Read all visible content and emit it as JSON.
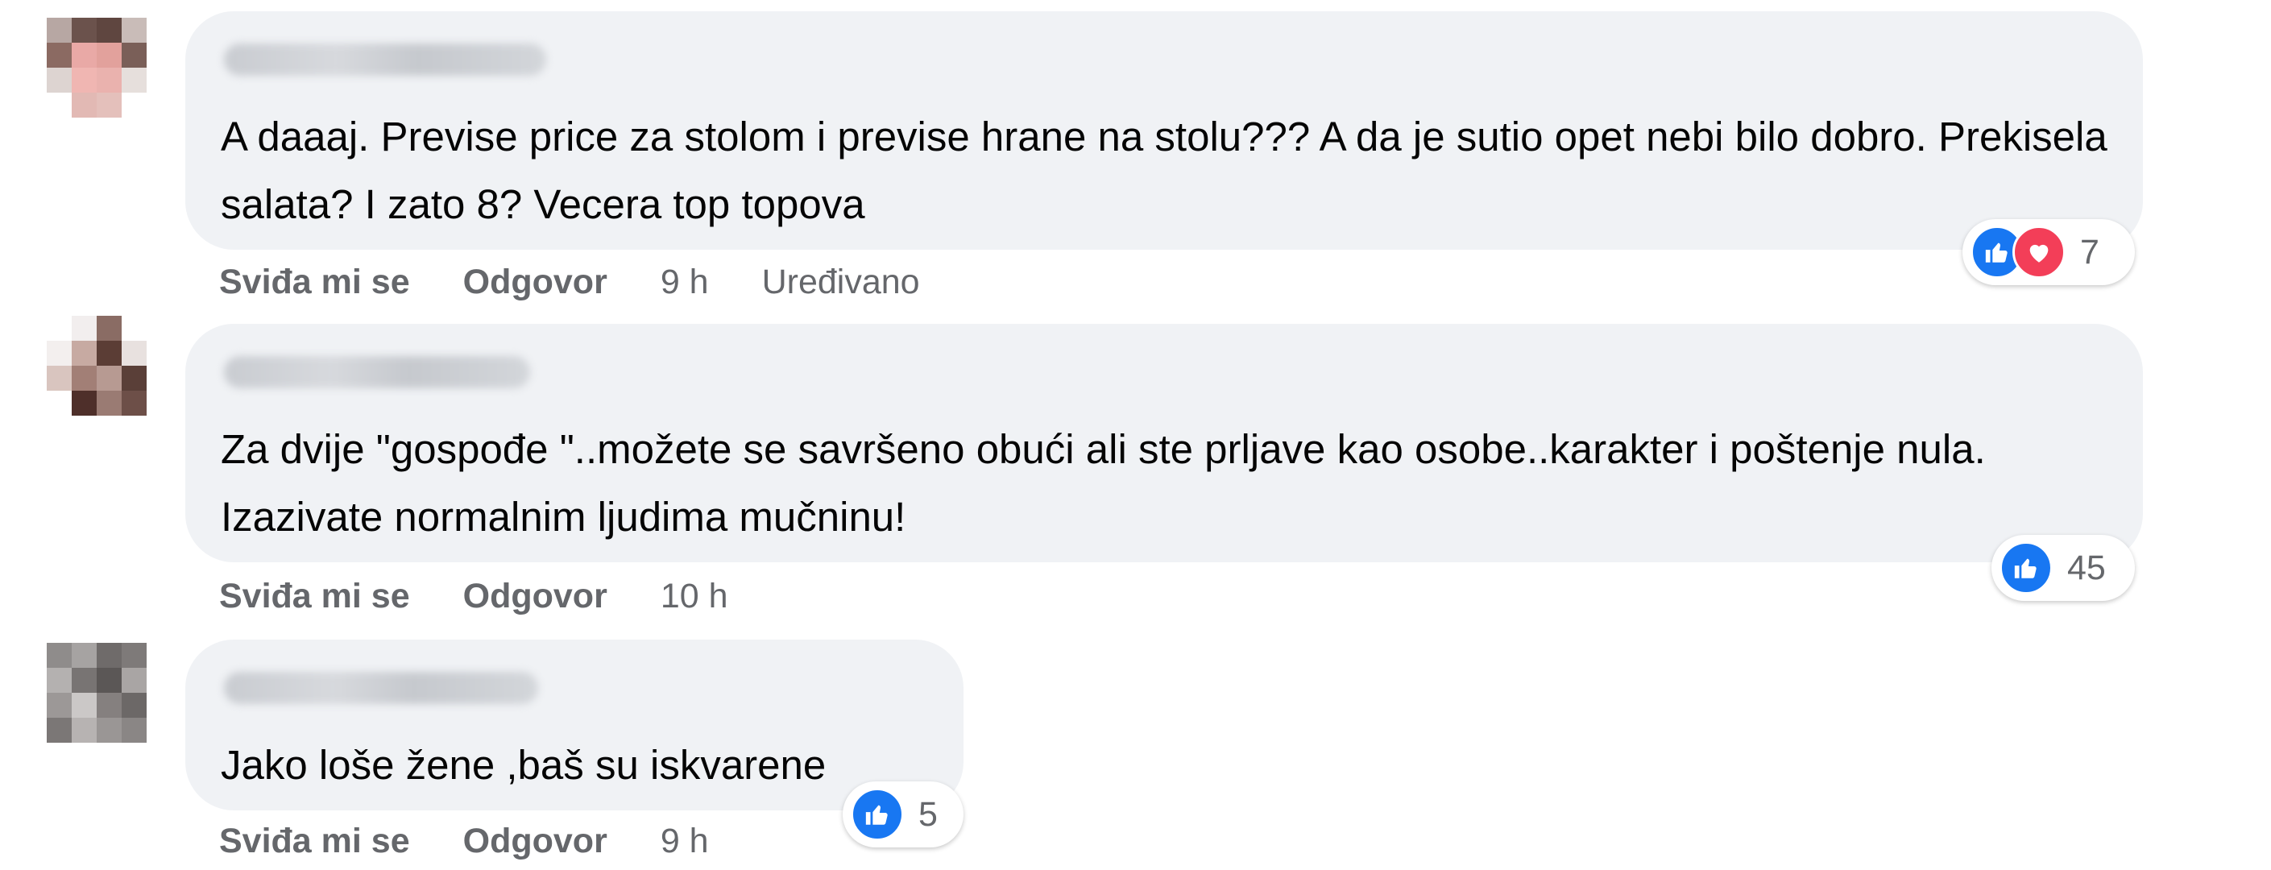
{
  "comments": [
    {
      "text": "A daaaj. Previse price za stolom i previse hrane na stolu??? A da je sutio opet nebi bilo dobro. Prekisela salata? I zato 8? Vecera top topova",
      "like_label": "Sviđa mi se",
      "reply_label": "Odgovor",
      "time": "9 h",
      "edited": "Uređivano",
      "reaction_count": "7",
      "reactions": [
        "like-icon",
        "love-icon"
      ]
    },
    {
      "text": "Za dvije \"gospođe \"..možete se savršeno obući ali ste prljave kao osobe..karakter i poštenje nula. Izazivate normalnim ljudima mučninu!",
      "like_label": "Sviđa mi se",
      "reply_label": "Odgovor",
      "time": "10 h",
      "reaction_count": "45",
      "reactions": [
        "like-icon"
      ]
    },
    {
      "text": "Jako loše žene ,baš su iskvarene",
      "like_label": "Sviđa mi se",
      "reply_label": "Odgovor",
      "time": "9 h",
      "reaction_count": "5",
      "reactions": [
        "like-icon"
      ]
    }
  ],
  "colors": {
    "bubble": "#f0f2f5",
    "like_blue": "#1877f2",
    "love_red": "#f33e58",
    "secondary_text": "#65676b"
  }
}
